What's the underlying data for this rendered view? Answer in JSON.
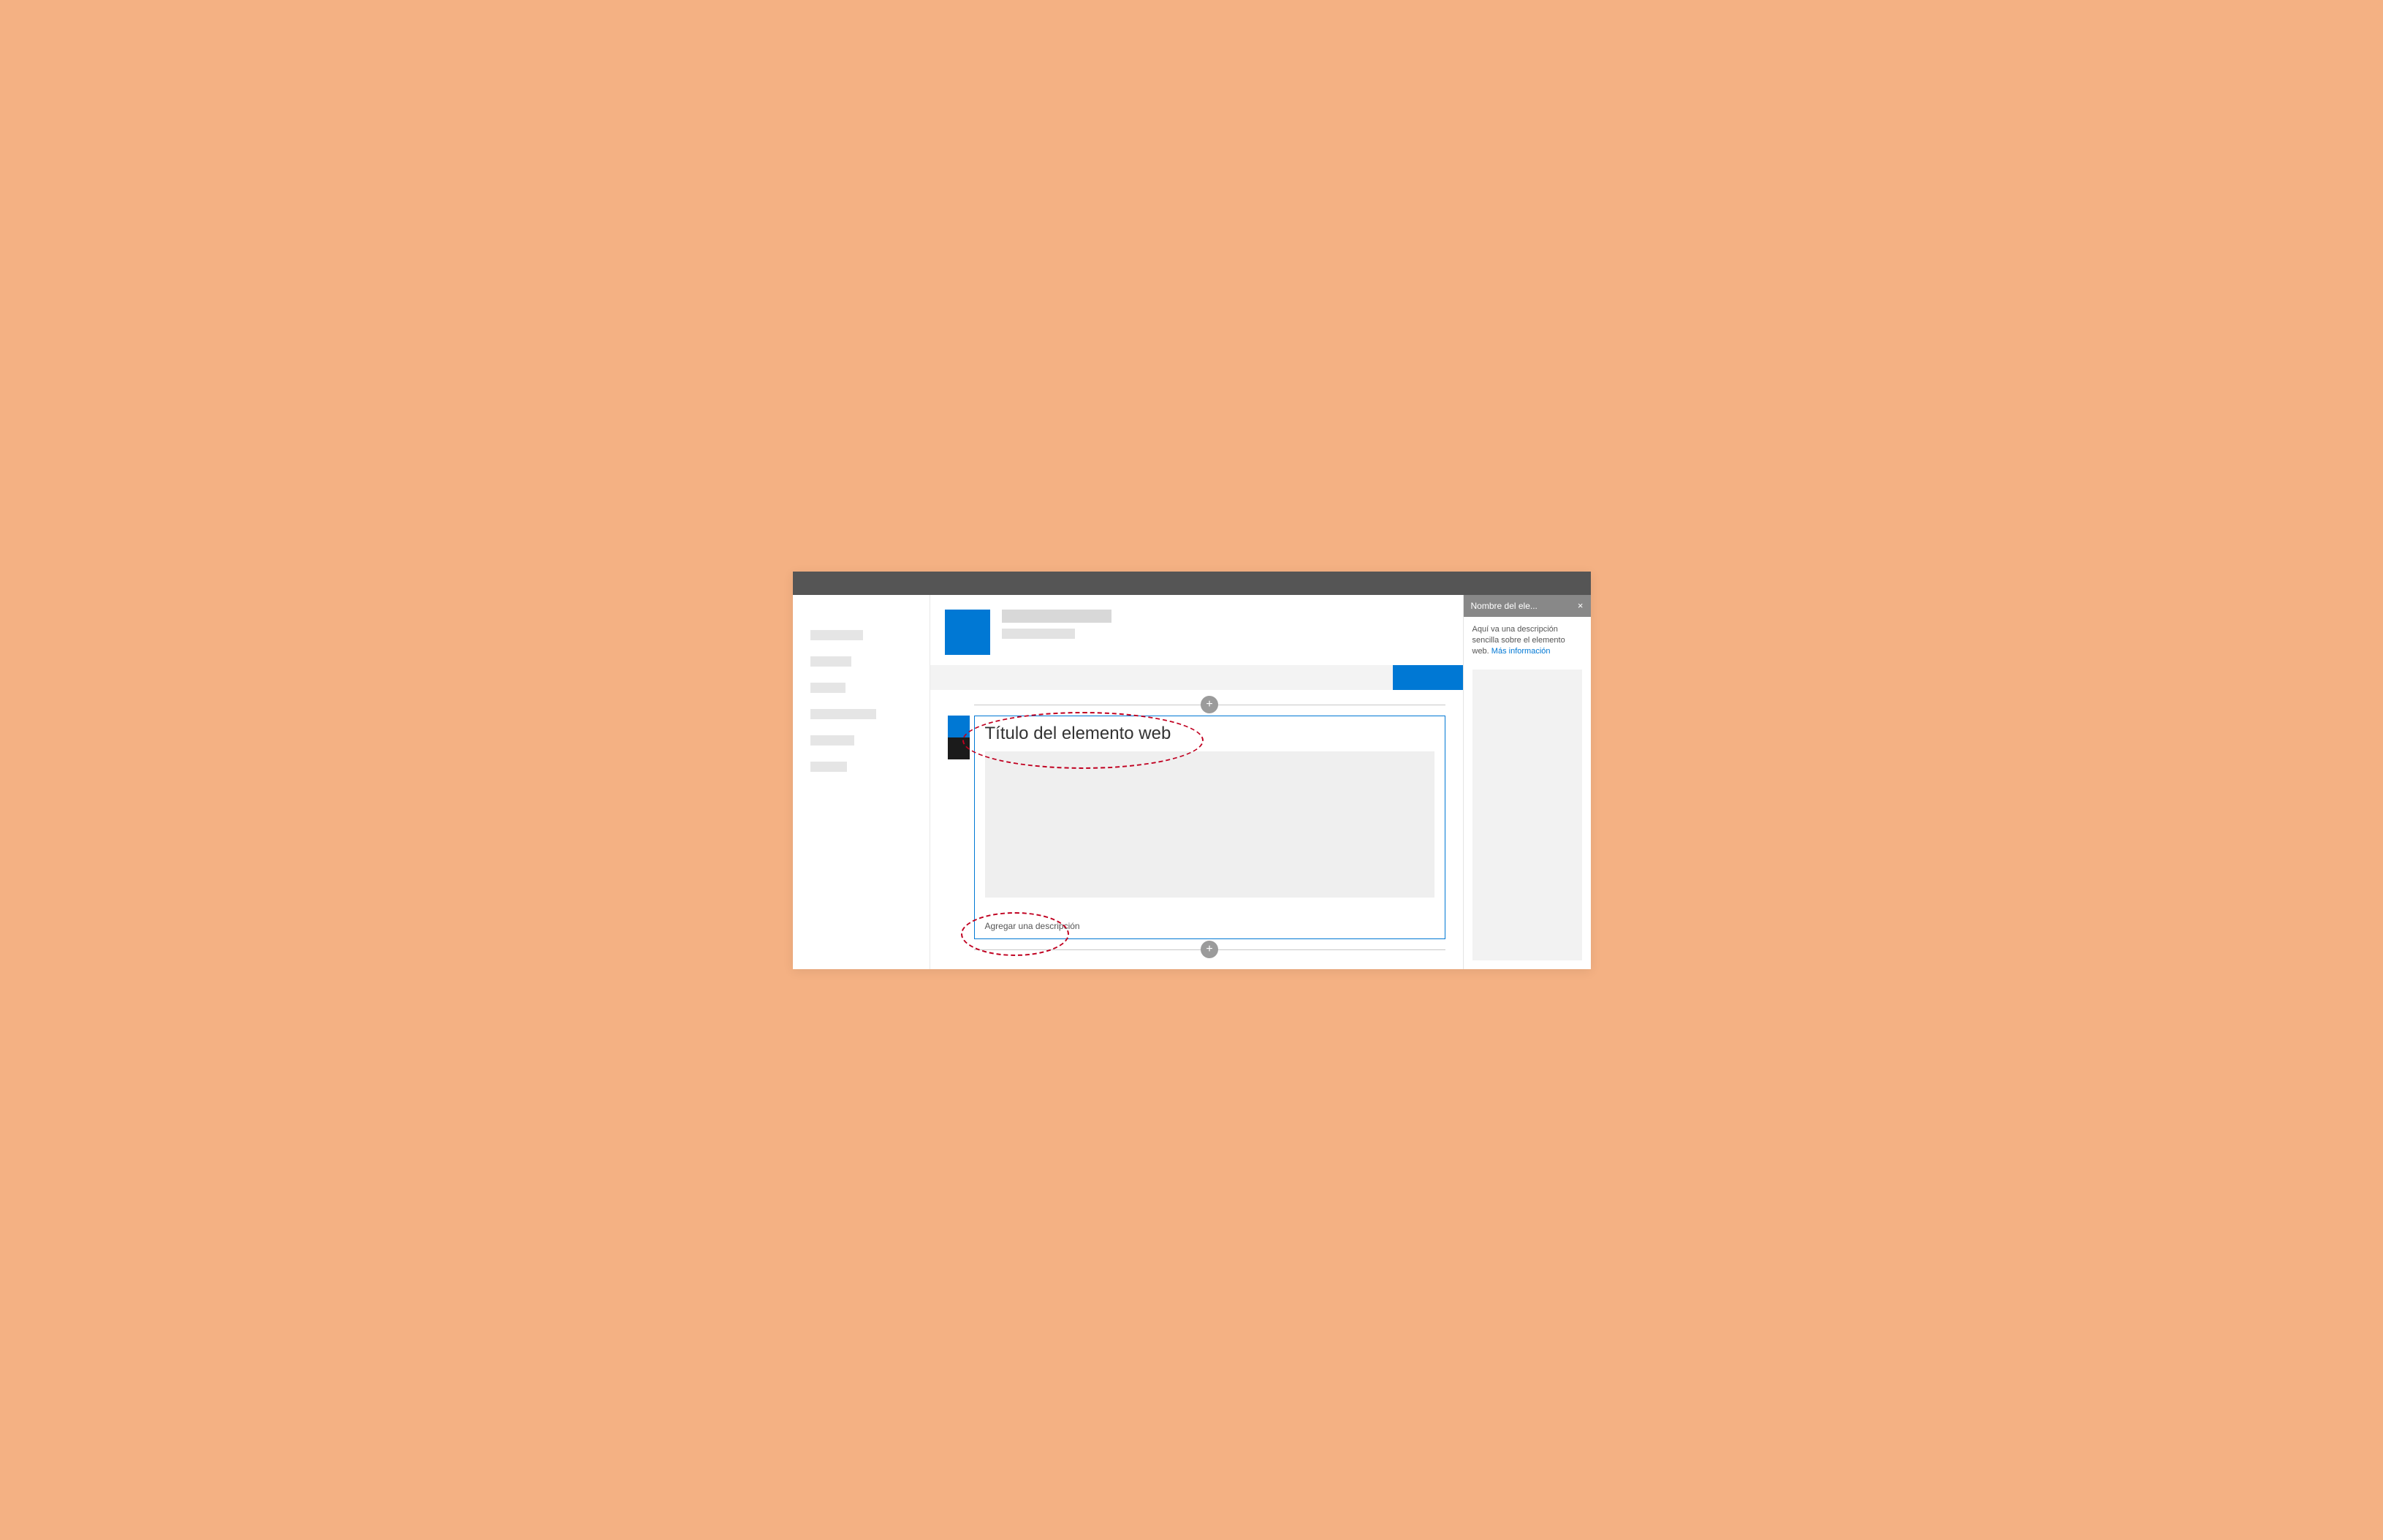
{
  "webpart": {
    "title": "Título del elemento web",
    "add_description_placeholder": "Agregar una descripción"
  },
  "panel": {
    "title": "Nombre del ele...",
    "description": "Aquí va una descripción sencilla sobre el elemento web. ",
    "more_info_label": "Más información"
  },
  "icons": {
    "plus": "+",
    "close": "×"
  }
}
